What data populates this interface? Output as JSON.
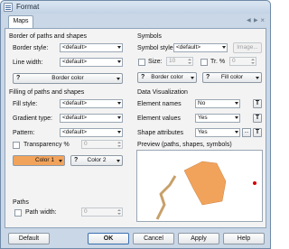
{
  "window": {
    "title": "Format"
  },
  "tabs": [
    {
      "label": "Maps"
    }
  ],
  "border_group": {
    "title": "Border of paths and shapes",
    "border_style_label": "Border style:",
    "border_style_value": "<default>",
    "line_width_label": "Line width:",
    "line_width_value": "<default>",
    "border_color_button": "Border color"
  },
  "filling_group": {
    "title": "Filling of paths and shapes",
    "fill_style_label": "Fill style:",
    "fill_style_value": "<default>",
    "gradient_type_label": "Gradient type:",
    "gradient_type_value": "<default>",
    "pattern_label": "Pattern:",
    "pattern_value": "<default>",
    "transparency_label": "Transparency %",
    "transparency_value": "0",
    "color1_button": "Color 1",
    "color2_button": "Color 2"
  },
  "paths_group": {
    "title": "Paths",
    "path_width_label": "Path width:",
    "path_width_value": "0"
  },
  "symbols_group": {
    "title": "Symbols",
    "symbol_style_label": "Symbol style",
    "symbol_style_value": "<default>",
    "image_button": "Image...",
    "size_label": "Size:",
    "size_value": "10",
    "transparency_label": "Tr. %",
    "transparency_value": "0",
    "border_color_button": "Border color",
    "fill_color_button": "Fill color"
  },
  "data_visualization": {
    "title": "Data Visualization",
    "rows": [
      {
        "label": "Element names",
        "value": "No"
      },
      {
        "label": "Element values",
        "value": "Yes"
      },
      {
        "label": "Shape attributes",
        "value": "Yes"
      }
    ],
    "t_label": "T",
    "dots_label": "..."
  },
  "preview": {
    "title": "Preview (paths, shapes, symbols)"
  },
  "footer": {
    "default_button": "Default",
    "ok_button": "OK",
    "cancel_button": "Cancel",
    "apply_button": "Apply",
    "help_button": "Help"
  },
  "colors": {
    "fill_swatch": "#f2a35b",
    "preview_path": "#c8a06a",
    "preview_shape": "#f2a35b",
    "preview_symbol": "#d40000"
  },
  "icons": {
    "question": "?",
    "tab_prev": "◀",
    "tab_next": "▶",
    "tab_close": "×"
  }
}
